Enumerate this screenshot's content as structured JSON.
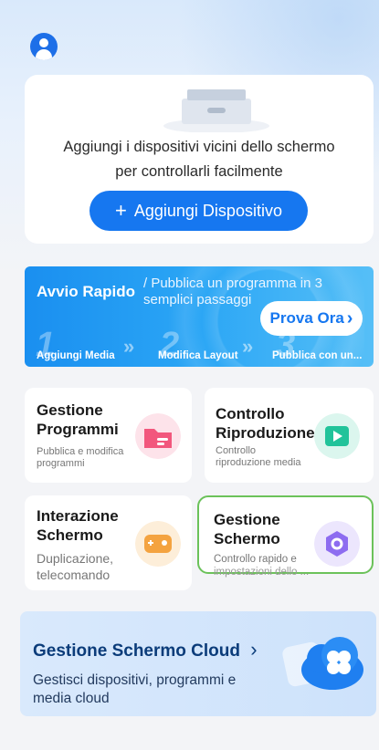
{
  "header": {
    "avatar_icon": "user-avatar-icon"
  },
  "add_device_card": {
    "description_line1": "Aggiungi i dispositivi vicini dello schermo",
    "description_line2": "per controllarli facilmente",
    "button_icon": "+",
    "button_label": "Aggiungi Dispositivo"
  },
  "quick_start": {
    "title": "Avvio Rapido",
    "subtitle": "/ Pubblica un programma in 3 semplici passaggi",
    "cta_label": "Prova Ora",
    "cta_chevron": "›",
    "steps": [
      {
        "number": "1",
        "label": "Aggiungi Media"
      },
      {
        "number": "2",
        "label": "Modifica Layout"
      },
      {
        "number": "3",
        "label": "Pubblica con un..."
      }
    ],
    "step_separator": "»"
  },
  "tiles": [
    {
      "title_line1": "Gestione",
      "title_line2": "Programmi",
      "subtitle_line1": "Pubblica e modifica",
      "subtitle_line2": "programmi",
      "icon": "folder-icon",
      "color": "#f2577d"
    },
    {
      "title_line1": "Controllo",
      "title_line2": "Riproduzione",
      "subtitle_line1": "Controllo",
      "subtitle_line2": "riproduzione media",
      "icon": "play-icon",
      "color": "#21c39a"
    },
    {
      "title_line1": "Interazione",
      "title_line2": "Schermo",
      "subtitle_line1": "Duplicazione,",
      "subtitle_line2": "telecomando",
      "icon": "remote-icon",
      "color": "#f4a340"
    },
    {
      "title_line1": "Gestione",
      "title_line2": "Schermo",
      "subtitle_line1": "Controllo rapido e",
      "subtitle_line2": "impostazioni dello ...",
      "icon": "hex-nut-icon",
      "color": "#8d6cf0"
    }
  ],
  "cloud": {
    "title": "Gestione Schermo Cloud",
    "title_chevron": "›",
    "subtitle_line1": "Gestisci dispositivi, programmi e",
    "subtitle_line2": "media cloud",
    "icon": "cloud-flower-icon"
  }
}
